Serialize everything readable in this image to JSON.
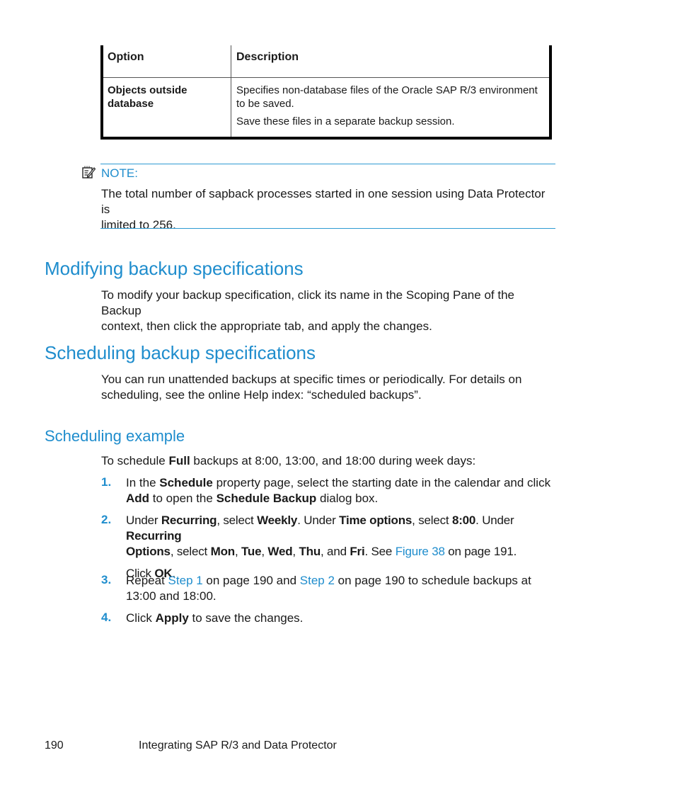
{
  "table": {
    "headers": [
      "Option",
      "Description"
    ],
    "rows": [
      {
        "option": "Objects outside database",
        "option_lines": [
          "Objects outside",
          "database"
        ],
        "description_lines": [
          "Specifies non-database files of the Oracle SAP R/3 environment",
          "to be saved."
        ],
        "description_extra": "Save these files in a separate backup session."
      }
    ]
  },
  "note": {
    "icon": "note-pencil-icon",
    "label": "NOTE:",
    "lines": [
      "The total number of sapback processes started in one session using Data Protector is",
      "limited to 256."
    ]
  },
  "sections": {
    "modifying": {
      "title": "Modifying backup specifications",
      "lines": [
        "To modify your backup specification, click its name in the Scoping Pane of the Backup",
        "context, then click the appropriate tab, and apply the changes."
      ]
    },
    "scheduling": {
      "title": "Scheduling backup specifications",
      "lines": [
        "You can run unattended backups at specific times or periodically. For details on",
        "scheduling, see the online Help index: “scheduled backups”."
      ]
    },
    "example": {
      "title": "Scheduling example",
      "intro_pre": "To schedule ",
      "intro_bold": "Full",
      "intro_post": " backups at 8:00, 13:00, and 18:00 during week days:"
    }
  },
  "steps": [
    {
      "number": "1.",
      "parts": {
        "a": "In the ",
        "b1": "Schedule",
        "c": " property page, select the starting date in the calendar and click",
        "b2": "Add",
        "d": " to open the ",
        "b3": "Schedule Backup",
        "e": " dialog box."
      }
    },
    {
      "number": "2.",
      "parts": {
        "a": "Under ",
        "b1": "Recurring",
        "c": ", select ",
        "b2": "Weekly",
        "d": ". Under ",
        "b3": "Time options",
        "e": ", select ",
        "b4": "8:00",
        "f": ". Under ",
        "b5": "Recurring",
        "b6": "Options",
        "g": ", select ",
        "b7": "Mon",
        "h": ", ",
        "b8": "Tue",
        "i": ", ",
        "b9": "Wed",
        "j": ", ",
        "b10": "Thu",
        "k": ", and ",
        "b11": "Fri",
        "l": ". See ",
        "link": "Figure 38",
        "m": " on page 191."
      },
      "sub_pre": "Click ",
      "sub_bold": "OK",
      "sub_post": "."
    },
    {
      "number": "3.",
      "parts": {
        "a": "Repeat ",
        "link1": "Step 1",
        "b": " on page 190 and ",
        "link2": "Step 2",
        "c": " on page 190 to schedule backups at",
        "d": "13:00 and 18:00."
      }
    },
    {
      "number": "4.",
      "parts": {
        "a": "Click ",
        "b1": "Apply",
        "c": " to save the changes."
      }
    }
  ],
  "footer": {
    "page_number": "190",
    "chapter_title": "Integrating SAP R/3 and Data Protector"
  }
}
